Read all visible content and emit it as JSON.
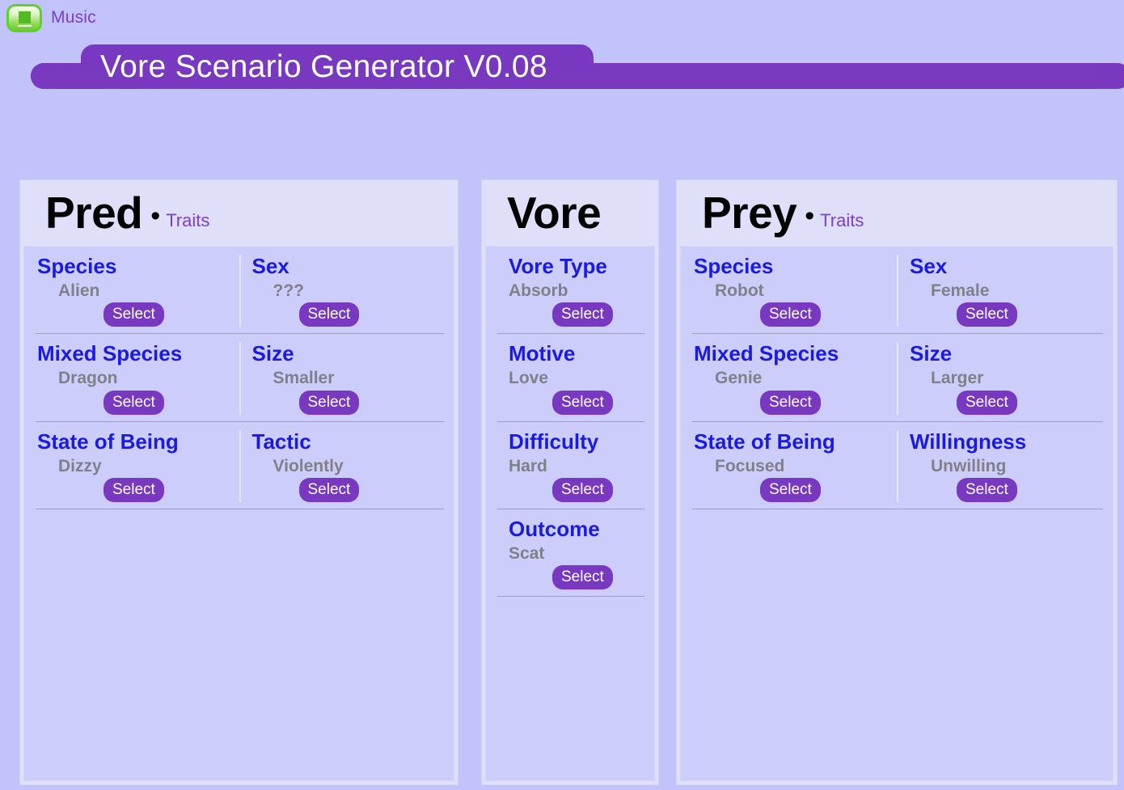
{
  "topbar": {
    "music_label": "Music",
    "music_icon": "stop-square-icon",
    "music_button_color": "#5ed12a"
  },
  "banner": {
    "title": "Vore Scenario Generator V0.08",
    "color": "#7839c0"
  },
  "theme": {
    "background": "#c3c3fc",
    "panel_header_bg": "#dfdffa",
    "panel_body_bg": "#cdcdfb",
    "label_color": "#1a1ae0",
    "value_color": "#808088",
    "accent_purple": "#7839c0"
  },
  "select_label": "Select",
  "panels": [
    {
      "id": "pred",
      "title": "Pred",
      "bullet": "•",
      "traits": "Traits",
      "columns": 2,
      "rows": [
        {
          "left": {
            "label": "Species",
            "value": "Alien",
            "button": "Select"
          },
          "right": {
            "label": "Sex",
            "value": "???",
            "button": "Select"
          }
        },
        {
          "left": {
            "label": "Mixed Species",
            "value": "Dragon",
            "button": "Select"
          },
          "right": {
            "label": "Size",
            "value": "Smaller",
            "button": "Select"
          }
        },
        {
          "left": {
            "label": "State of Being",
            "value": "Dizzy",
            "button": "Select"
          },
          "right": {
            "label": "Tactic",
            "value": "Violently",
            "button": "Select"
          }
        }
      ]
    },
    {
      "id": "vore",
      "title": "Vore",
      "bullet": "",
      "traits": "",
      "columns": 1,
      "rows": [
        {
          "full": {
            "label": "Vore Type",
            "value": "Absorb",
            "button": "Select"
          }
        },
        {
          "full": {
            "label": "Motive",
            "value": "Love",
            "button": "Select"
          }
        },
        {
          "full": {
            "label": "Difficulty",
            "value": "Hard",
            "button": "Select"
          }
        },
        {
          "full": {
            "label": "Outcome",
            "value": "Scat",
            "button": "Select"
          }
        }
      ]
    },
    {
      "id": "prey",
      "title": "Prey",
      "bullet": "•",
      "traits": "Traits",
      "columns": 2,
      "rows": [
        {
          "left": {
            "label": "Species",
            "value": "Robot",
            "button": "Select"
          },
          "right": {
            "label": "Sex",
            "value": "Female",
            "button": "Select"
          }
        },
        {
          "left": {
            "label": "Mixed Species",
            "value": "Genie",
            "button": "Select"
          },
          "right": {
            "label": "Size",
            "value": "Larger",
            "button": "Select"
          }
        },
        {
          "left": {
            "label": "State of Being",
            "value": "Focused",
            "button": "Select"
          },
          "right": {
            "label": "Willingness",
            "value": "Unwilling",
            "button": "Select"
          }
        }
      ]
    }
  ]
}
